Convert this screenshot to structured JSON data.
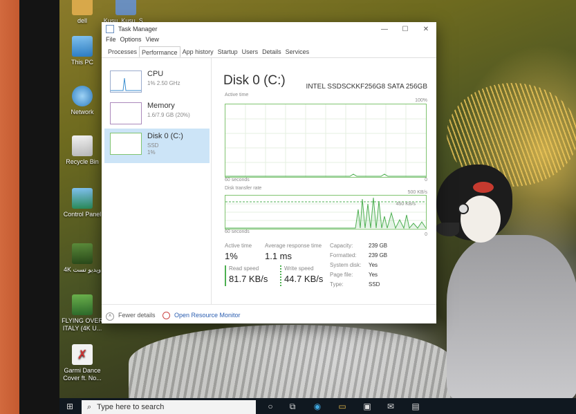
{
  "desktop_icons": [
    {
      "label": "dell"
    },
    {
      "label": "Kusu_Kusu_S..."
    },
    {
      "label": "This PC"
    },
    {
      "label": "Network"
    },
    {
      "label": "Recycle Bin"
    },
    {
      "label": "Control Panel"
    },
    {
      "label": "4K ویدیو تست"
    },
    {
      "label": "FLYING OVER ITALY (4K U..."
    },
    {
      "label": "Garmi Dance Cover ft. No..."
    }
  ],
  "window": {
    "title": "Task Manager",
    "controls": {
      "minimize": "—",
      "maximize": "☐",
      "close": "✕"
    },
    "menu": [
      "File",
      "Options",
      "View"
    ],
    "tabs": [
      "Processes",
      "Performance",
      "App history",
      "Startup",
      "Users",
      "Details",
      "Services"
    ],
    "active_tab": "Performance"
  },
  "sidebar": {
    "items": [
      {
        "title": "CPU",
        "sub1": "1% 2.50 GHz",
        "sub2": ""
      },
      {
        "title": "Memory",
        "sub1": "1.6/7.9 GB (20%)",
        "sub2": ""
      },
      {
        "title": "Disk 0 (C:)",
        "sub1": "SSD",
        "sub2": "1%"
      }
    ],
    "selected": "Disk 0 (C:)"
  },
  "disk": {
    "title": "Disk 0 (C:)",
    "model": "INTEL SSDSCKKF256G8 SATA 256GB",
    "graph1": {
      "label": "Active time",
      "max": "100%",
      "time": "60 seconds",
      "min": "0"
    },
    "graph2": {
      "label": "Disk transfer rate",
      "max": "500 KB/s",
      "mid": "450 KB/s",
      "time": "60 seconds",
      "min": "0"
    },
    "stats": {
      "active_time_label": "Active time",
      "active_time": "1%",
      "response_label": "Average response time",
      "response": "1.1 ms",
      "read_label": "Read speed",
      "read": "81.7 KB/s",
      "write_label": "Write speed",
      "write": "44.7 KB/s"
    },
    "properties": [
      {
        "key": "Capacity:",
        "value": "239 GB"
      },
      {
        "key": "Formatted:",
        "value": "239 GB"
      },
      {
        "key": "System disk:",
        "value": "Yes"
      },
      {
        "key": "Page file:",
        "value": "Yes"
      },
      {
        "key": "Type:",
        "value": "SSD"
      }
    ]
  },
  "footer": {
    "fewer_details": "Fewer details",
    "resource_monitor": "Open Resource Monitor"
  },
  "taskbar": {
    "search_placeholder": "Type here to search"
  }
}
